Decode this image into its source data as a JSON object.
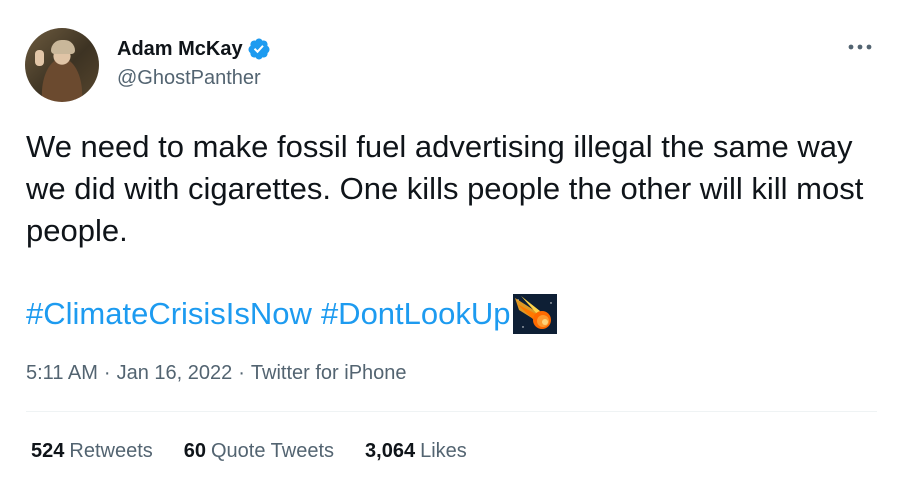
{
  "author": {
    "name": "Adam McKay",
    "handle": "@GhostPanther",
    "verified": true
  },
  "tweet": {
    "text": "We need to make fossil fuel advertising illegal the same way we did with cigarettes. One kills people the other will kill most people.",
    "hashtags": [
      "#ClimateCrisisIsNow",
      "#DontLookUp"
    ],
    "emoji": "comet-icon",
    "time": "5:11 AM",
    "date": "Jan 16, 2022",
    "source": "Twitter for iPhone",
    "separator": "·"
  },
  "stats": {
    "retweets": {
      "count": "524",
      "label": "Retweets"
    },
    "quotes": {
      "count": "60",
      "label": "Quote Tweets"
    },
    "likes": {
      "count": "3,064",
      "label": "Likes"
    }
  },
  "colors": {
    "link": "#1d9bf0",
    "secondary_text": "#536471",
    "primary_text": "#0f1419",
    "divider": "#eff3f4"
  },
  "icons": [
    "avatar",
    "verified-badge-icon",
    "more-options-icon",
    "comet-icon"
  ]
}
